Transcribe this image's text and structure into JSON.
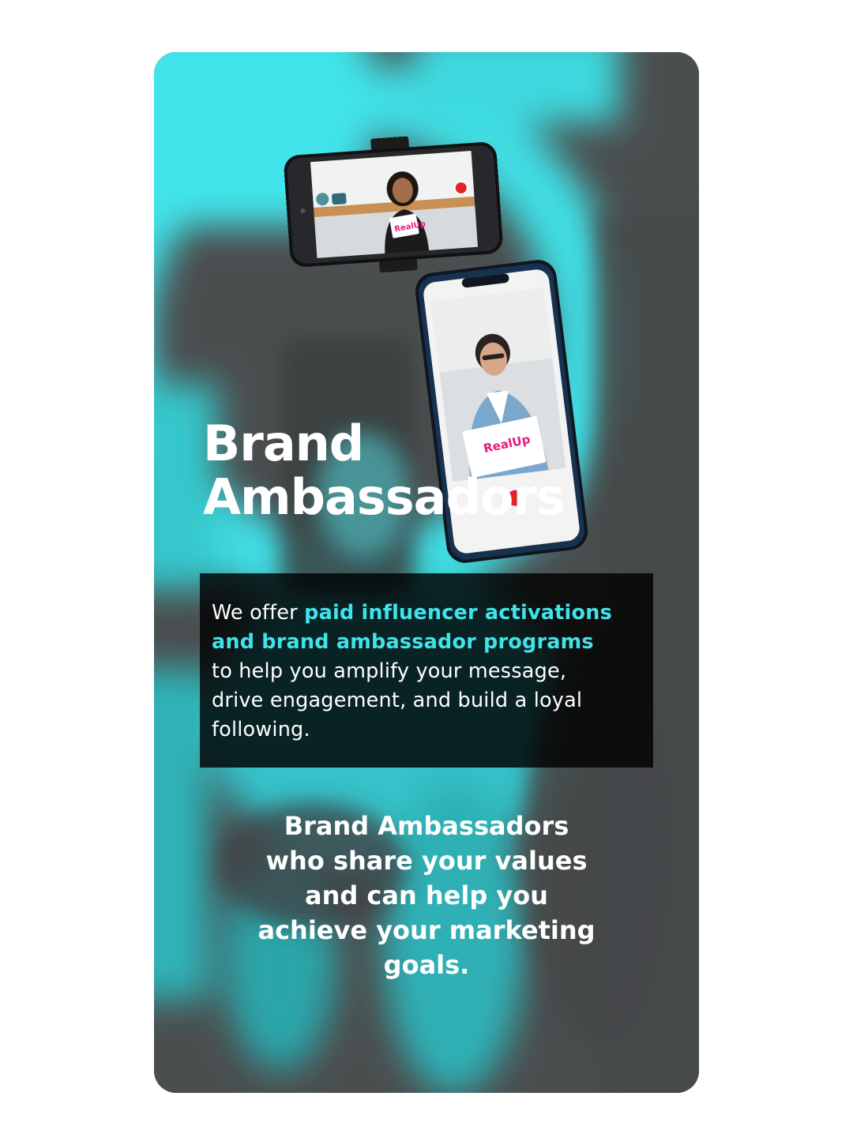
{
  "headline": {
    "line1": "Brand",
    "line2": "Ambassadors"
  },
  "info": {
    "prefix": "We offer ",
    "highlight_line1": "paid influencer activations",
    "highlight_line2": "and brand ambassador programs",
    "rest_line1": "to help you amplify your message,",
    "rest_line2": "drive engagement, and build a loyal",
    "rest_line3": "following."
  },
  "tagline": {
    "line1": "Brand Ambassadors",
    "line2": "who share your values",
    "line3": "and can help you",
    "line4": "achieve your marketing",
    "line5": "goals."
  },
  "logo_text": "RealUp",
  "colors": {
    "accent": "#3fe4ea",
    "card_background": "#4a4d4e",
    "box_background": "#000000",
    "text": "#ffffff",
    "record_button": "#e0242a",
    "logo_pink": "#e6197d"
  }
}
